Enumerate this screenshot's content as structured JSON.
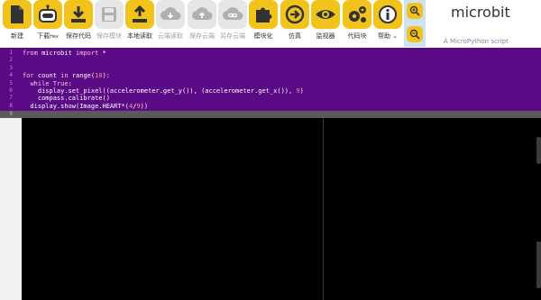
{
  "toolbar": {
    "new": {
      "label": "新建",
      "icon": "file-icon"
    },
    "download": {
      "label": "下载",
      "suffix": "Hex",
      "icon": "download-icon"
    },
    "save_code": {
      "label": "保存代码",
      "icon": "save-icon"
    },
    "save_module": {
      "label": "保存模块",
      "icon": "save-icon",
      "disabled": true
    },
    "local_read": {
      "label": "本地读取",
      "icon": "upload-icon"
    },
    "cloud_read": {
      "label": "云端读取",
      "icon": "cloud-download-icon",
      "disabled": true
    },
    "save_cloud": {
      "label": "保存云端",
      "icon": "cloud-upload-icon",
      "disabled": true
    },
    "save_as_cloud": {
      "label": "另存云端",
      "icon": "cloud-link-icon",
      "disabled": true
    },
    "blocks": {
      "label": "模块化",
      "icon": "puzzle-icon"
    },
    "simulate": {
      "label": "仿真",
      "icon": "arrow-right-icon"
    },
    "monitor": {
      "label": "监视器",
      "icon": "eye-icon"
    },
    "code_blocks": {
      "label": "代码块",
      "icon": "gears-icon"
    },
    "help": {
      "label": "帮助 ⌄",
      "icon": "info-icon"
    }
  },
  "brand": {
    "title": "microbit",
    "subtitle": "A MicroPython script"
  },
  "editor": {
    "line_numbers": [
      "1",
      "2",
      "3",
      "4",
      "5",
      "6",
      "7",
      "8",
      "9"
    ],
    "lines": {
      "l1": {
        "kw1": "from",
        "t1": " microbit ",
        "kw2": "import",
        "t2": " *"
      },
      "l4": {
        "kw1": "for",
        "t1": " count ",
        "kw2": "in",
        "t2": " range(",
        "n1": "10",
        "t3": "):"
      },
      "l5": {
        "t0": "  ",
        "kw1": "while",
        "t1": " ",
        "kw2": "True",
        "t2": ":"
      },
      "l6": {
        "t0": "    display.set_pixel((accelerometer.get_y()), (accelerometer.get_x()), ",
        "n1": "9",
        "t1": ")"
      },
      "l7": {
        "t0": "    compass.calibrate()"
      },
      "l8": {
        "t0": "  display.show(Image.HEART*(",
        "n1": "4",
        "t1": "/",
        "n2": "9",
        "t2": "))"
      }
    }
  },
  "colors": {
    "accent": "#f2c31a",
    "editor_bg": "#5b0a86"
  }
}
